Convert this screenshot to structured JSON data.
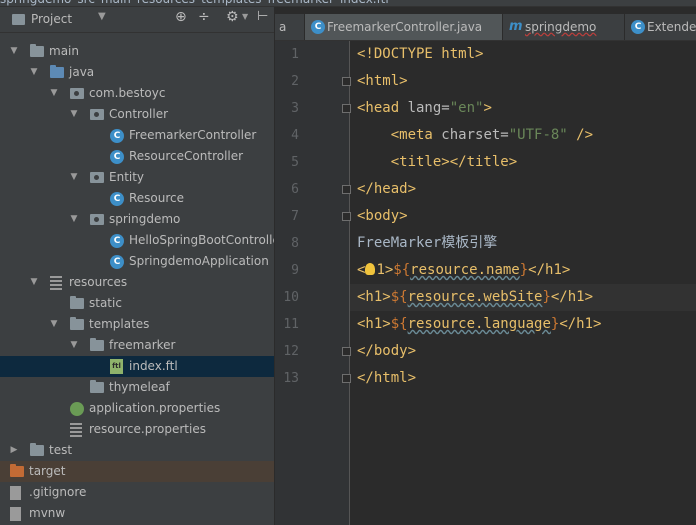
{
  "breadcrumb": [
    "springdemo",
    "src",
    "main",
    "resources",
    "templates",
    "freemarker",
    "index.ftl"
  ],
  "project_panel": {
    "title": "Project",
    "toolbar_icons": [
      "crosshair-icon",
      "collapse-icon",
      "gear-icon",
      "hide-icon"
    ]
  },
  "tree": [
    {
      "label": "main",
      "depth": 0,
      "arrow": "down",
      "icon": "folder"
    },
    {
      "label": "java",
      "depth": 1,
      "arrow": "down",
      "icon": "folder-blue"
    },
    {
      "label": "com.bestoyc",
      "depth": 2,
      "arrow": "down",
      "icon": "package"
    },
    {
      "label": "Controller",
      "depth": 3,
      "arrow": "down",
      "icon": "package"
    },
    {
      "label": "FreemarkerController",
      "depth": 4,
      "arrow": "",
      "icon": "class"
    },
    {
      "label": "ResourceController",
      "depth": 4,
      "arrow": "",
      "icon": "class"
    },
    {
      "label": "Entity",
      "depth": 3,
      "arrow": "down",
      "icon": "package"
    },
    {
      "label": "Resource",
      "depth": 4,
      "arrow": "",
      "icon": "class"
    },
    {
      "label": "springdemo",
      "depth": 3,
      "arrow": "down",
      "icon": "package"
    },
    {
      "label": "HelloSpringBootController",
      "depth": 4,
      "arrow": "",
      "icon": "class"
    },
    {
      "label": "SpringdemoApplication",
      "depth": 4,
      "arrow": "",
      "icon": "class"
    },
    {
      "label": "resources",
      "depth": 1,
      "arrow": "down",
      "icon": "props"
    },
    {
      "label": "static",
      "depth": 2,
      "arrow": "",
      "icon": "folder"
    },
    {
      "label": "templates",
      "depth": 2,
      "arrow": "down",
      "icon": "folder"
    },
    {
      "label": "freemarker",
      "depth": 3,
      "arrow": "down",
      "icon": "folder"
    },
    {
      "label": "index.ftl",
      "depth": 4,
      "arrow": "",
      "icon": "ftl",
      "selected": true
    },
    {
      "label": "thymeleaf",
      "depth": 3,
      "arrow": "",
      "icon": "folder"
    },
    {
      "label": "application.properties",
      "depth": 2,
      "arrow": "",
      "icon": "leaf"
    },
    {
      "label": "resource.properties",
      "depth": 2,
      "arrow": "",
      "icon": "props"
    },
    {
      "label": "test",
      "depth": 0,
      "arrow": "right",
      "icon": "folder"
    },
    {
      "label": "target",
      "depth": -1,
      "arrow": "",
      "icon": "folder-orange",
      "highlight": true
    },
    {
      "label": ".gitignore",
      "depth": -1,
      "arrow": "",
      "icon": "file"
    },
    {
      "label": "mvnw",
      "depth": -1,
      "arrow": "",
      "icon": "file"
    }
  ],
  "tabs": [
    {
      "label": "a",
      "icon": "none"
    },
    {
      "label": "FreemarkerController.java",
      "icon": "class"
    },
    {
      "label": "springdemo",
      "icon": "m"
    },
    {
      "label": "Extende",
      "icon": "class2"
    }
  ],
  "editor": {
    "line_numbers": [
      "1",
      "2",
      "3",
      "4",
      "5",
      "6",
      "7",
      "8",
      "9",
      "10",
      "11",
      "12",
      "13"
    ],
    "lines": [
      {
        "parts": [
          [
            "tag",
            "<!DOCTYPE html>"
          ]
        ]
      },
      {
        "parts": [
          [
            "tag",
            "<html>"
          ]
        ]
      },
      {
        "parts": [
          [
            "tag",
            "<head "
          ],
          [
            "attr",
            "lang="
          ],
          [
            "str",
            "\"en\""
          ],
          [
            "tag",
            ">"
          ]
        ]
      },
      {
        "parts": [
          [
            "tag",
            "    <meta "
          ],
          [
            "attr",
            "charset="
          ],
          [
            "str",
            "\"UTF-8\""
          ],
          [
            "tag",
            " />"
          ]
        ]
      },
      {
        "parts": [
          [
            "tag",
            "    <title></title>"
          ]
        ]
      },
      {
        "parts": [
          [
            "tag",
            "</head>"
          ]
        ]
      },
      {
        "parts": [
          [
            "tag",
            "<body>"
          ]
        ]
      },
      {
        "parts": [
          [
            "txt",
            "FreeMarker模板引擎"
          ]
        ]
      },
      {
        "parts": [
          [
            "tag",
            "<"
          ],
          [
            "bulb",
            ""
          ],
          [
            "tag",
            "1>"
          ],
          [
            "dollar",
            "${"
          ],
          [
            "expr",
            "resource.name"
          ],
          [
            "dollar",
            "}"
          ],
          [
            "tag",
            "</h1>"
          ]
        ]
      },
      {
        "parts": [
          [
            "tag",
            "<h1>"
          ],
          [
            "dollar",
            "${"
          ],
          [
            "expr",
            "resource.webSite"
          ],
          [
            "dollar",
            "}"
          ],
          [
            "tag",
            "</h1>"
          ]
        ]
      },
      {
        "parts": [
          [
            "tag",
            "<h1>"
          ],
          [
            "dollar",
            "${"
          ],
          [
            "expr",
            "resource.language"
          ],
          [
            "dollar",
            "}"
          ],
          [
            "tag",
            "</h1>"
          ]
        ]
      },
      {
        "parts": [
          [
            "tag",
            "</body>"
          ]
        ]
      },
      {
        "parts": [
          [
            "tag",
            "</html>"
          ]
        ]
      }
    ]
  }
}
